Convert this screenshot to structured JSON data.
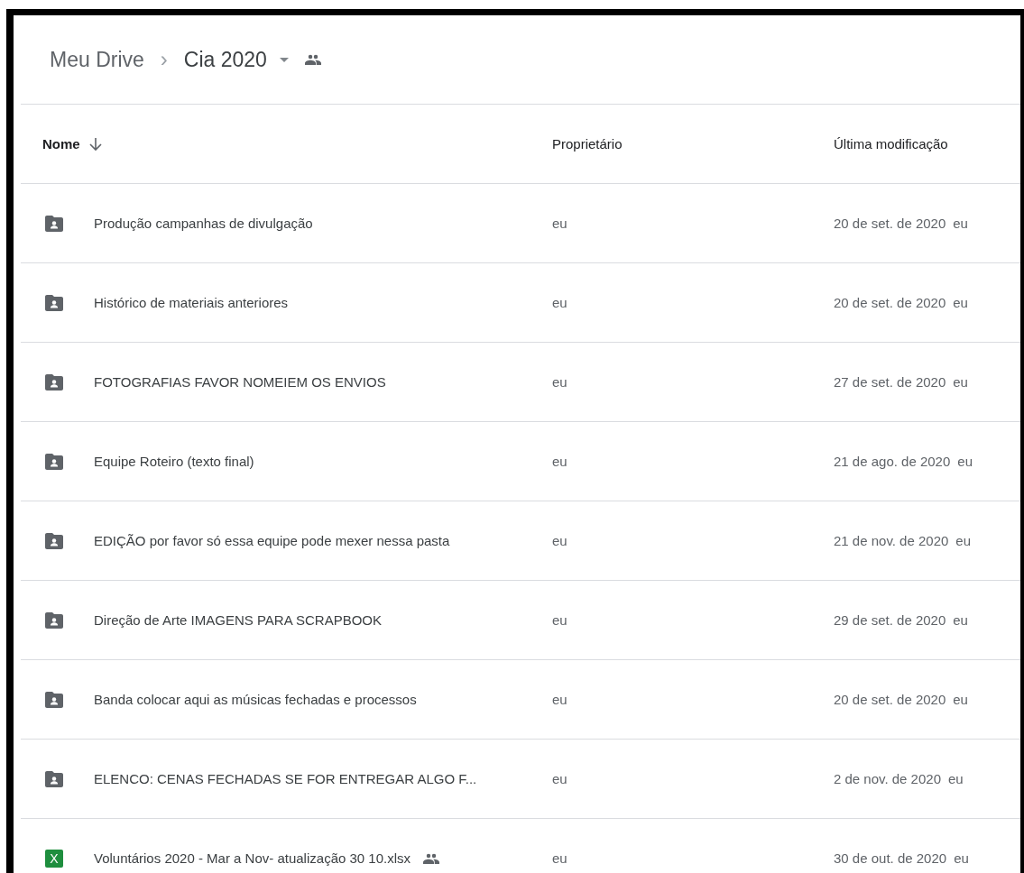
{
  "breadcrumb": {
    "root": "Meu Drive",
    "separator": "›",
    "current": "Cia 2020",
    "shared": true
  },
  "table": {
    "columns": [
      {
        "label": "Nome",
        "sorted": true
      },
      {
        "label": "Proprietário",
        "sorted": false
      },
      {
        "label": "Última modificação",
        "sorted": false
      }
    ],
    "rows": [
      {
        "icon": {
          "kind": "shared_folder"
        },
        "name": "Produção campanhas de divulgação",
        "shared": false,
        "owner": "eu",
        "modified": "20 de set. de 2020",
        "modified_by": "eu"
      },
      {
        "icon": {
          "kind": "shared_folder"
        },
        "name": "Histórico de materiais anteriores",
        "shared": false,
        "owner": "eu",
        "modified": "20 de set. de 2020",
        "modified_by": "eu"
      },
      {
        "icon": {
          "kind": "shared_folder"
        },
        "name": "FOTOGRAFIAS FAVOR NOMEIEM OS ENVIOS",
        "shared": false,
        "owner": "eu",
        "modified": "27 de set. de 2020",
        "modified_by": "eu"
      },
      {
        "icon": {
          "kind": "shared_folder"
        },
        "name": "Equipe Roteiro (texto final)",
        "shared": false,
        "owner": "eu",
        "modified": "21 de ago. de 2020",
        "modified_by": "eu"
      },
      {
        "icon": {
          "kind": "shared_folder"
        },
        "name": "EDIÇÃO por favor só essa equipe pode mexer nessa pasta",
        "shared": false,
        "owner": "eu",
        "modified": "21 de nov. de 2020",
        "modified_by": "eu"
      },
      {
        "icon": {
          "kind": "shared_folder"
        },
        "name": "Direção de Arte IMAGENS PARA SCRAPBOOK",
        "shared": false,
        "owner": "eu",
        "modified": "29 de set. de 2020",
        "modified_by": "eu"
      },
      {
        "icon": {
          "kind": "shared_folder"
        },
        "name": "Banda colocar aqui as músicas fechadas e processos",
        "shared": false,
        "owner": "eu",
        "modified": "20 de set. de 2020",
        "modified_by": "eu"
      },
      {
        "icon": {
          "kind": "shared_folder"
        },
        "name": "ELENCO: CENAS FECHADAS SE FOR ENTREGAR ALGO F...",
        "shared": false,
        "owner": "eu",
        "modified": "2 de nov. de 2020",
        "modified_by": "eu"
      },
      {
        "icon": {
          "kind": "spreadsheet",
          "glyph": "X"
        },
        "name": "Voluntários 2020 - Mar a Nov- atualização 30 10.xlsx",
        "shared": true,
        "owner": "eu",
        "modified": "30 de out. de 2020",
        "modified_by": "eu"
      }
    ]
  }
}
